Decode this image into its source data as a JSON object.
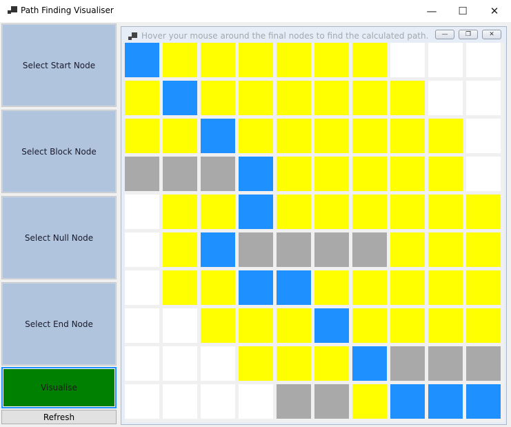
{
  "window": {
    "title": "Path Finding Visualiser",
    "minimize_glyph": "—",
    "maximize_glyph": "☐",
    "close_glyph": "✕"
  },
  "sidebar": {
    "select_start_label": "Select Start Node",
    "select_block_label": "Select Block Node",
    "select_null_label": "Select Null Node",
    "select_end_label": "Select End Node",
    "visualise_label": "Visualise",
    "refresh_label": "Refresh"
  },
  "mdi": {
    "title": "Hover your mouse around the final nodes to find the calculated path.",
    "minimize_glyph": "—",
    "restore_glyph": "❐",
    "close_glyph": "✕"
  },
  "colors": {
    "P": "#1e90ff",
    "Y": "#ffff00",
    "W": "#ffffff",
    "B": "#a9a9a9"
  },
  "grid": {
    "rows": [
      [
        "P",
        "Y",
        "Y",
        "Y",
        "Y",
        "Y",
        "Y",
        "W",
        "W",
        "W"
      ],
      [
        "Y",
        "P",
        "Y",
        "Y",
        "Y",
        "Y",
        "Y",
        "Y",
        "W",
        "W"
      ],
      [
        "Y",
        "Y",
        "P",
        "Y",
        "Y",
        "Y",
        "Y",
        "Y",
        "Y",
        "W"
      ],
      [
        "B",
        "B",
        "B",
        "P",
        "Y",
        "Y",
        "Y",
        "Y",
        "Y",
        "W"
      ],
      [
        "W",
        "Y",
        "Y",
        "P",
        "Y",
        "Y",
        "Y",
        "Y",
        "Y",
        "Y"
      ],
      [
        "W",
        "Y",
        "P",
        "B",
        "B",
        "B",
        "B",
        "Y",
        "Y",
        "Y"
      ],
      [
        "W",
        "Y",
        "Y",
        "P",
        "P",
        "Y",
        "Y",
        "Y",
        "Y",
        "Y"
      ],
      [
        "W",
        "W",
        "Y",
        "Y",
        "Y",
        "P",
        "Y",
        "Y",
        "Y",
        "Y"
      ],
      [
        "W",
        "W",
        "W",
        "Y",
        "Y",
        "Y",
        "P",
        "B",
        "B",
        "B"
      ],
      [
        "W",
        "W",
        "W",
        "W",
        "B",
        "B",
        "Y",
        "P",
        "P",
        "P"
      ]
    ]
  }
}
